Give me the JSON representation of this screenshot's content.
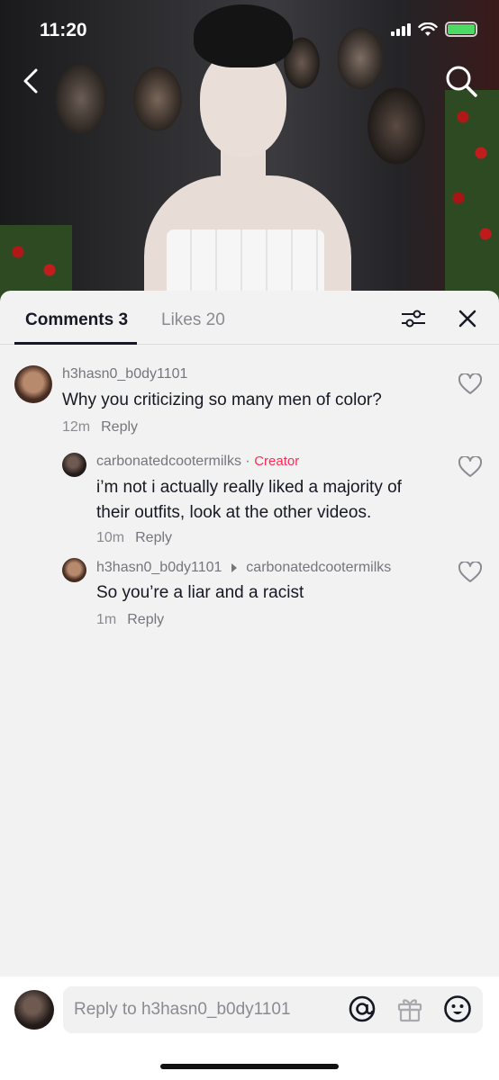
{
  "status_bar": {
    "time": "11:20"
  },
  "nav": {
    "back_icon": "chevron-left-icon",
    "search_icon": "search-icon"
  },
  "tabs": {
    "comments": "Comments 3",
    "likes": "Likes 20"
  },
  "comments": [
    {
      "username": "h3hasn0_b0dy1101",
      "text": "Why you criticizing so many men of color?",
      "time": "12m",
      "reply_label": "Reply"
    }
  ],
  "replies": [
    {
      "username": "carbonatedcootermilks",
      "separator": "·",
      "badge": "Creator",
      "text_line1": "i’m not i actually really liked a majority of",
      "text_line2": "their outfits, look at the other videos.",
      "time": "10m",
      "reply_label": "Reply"
    },
    {
      "username": "h3hasn0_b0dy1101",
      "reply_to": "carbonatedcootermilks",
      "text": "So you’re a liar and a racist",
      "time": "1m",
      "reply_label": "Reply"
    }
  ],
  "input": {
    "placeholder": "Reply to h3hasn0_b0dy1101"
  },
  "colors": {
    "creator": "#fe2c55",
    "text": "#161823",
    "muted": "#8a8b91",
    "sheet_bg": "#f2f2f3"
  }
}
